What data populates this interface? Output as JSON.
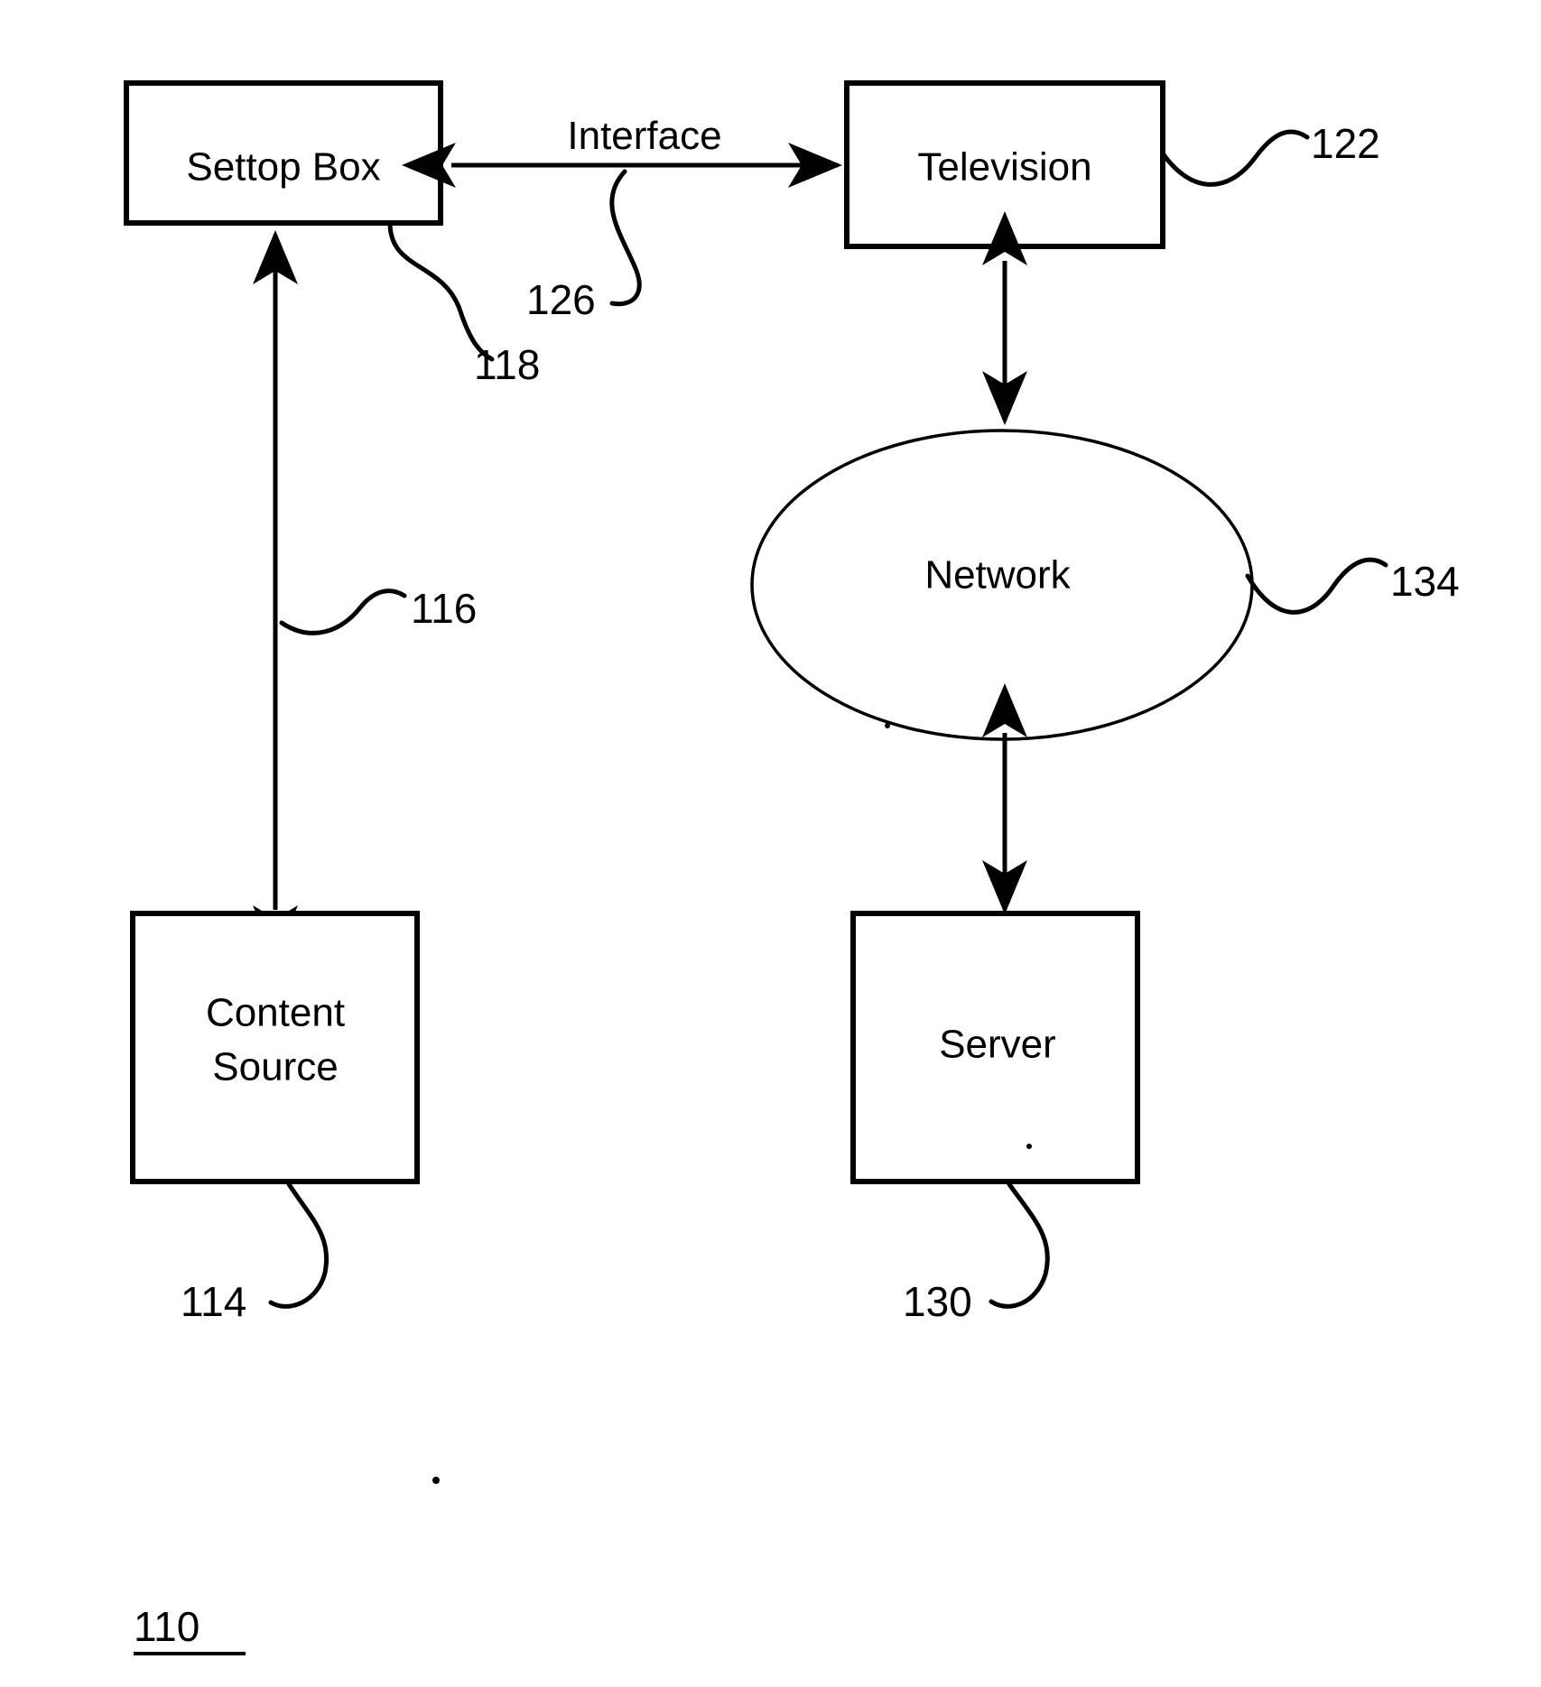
{
  "figure": {
    "figure_number": "110",
    "nodes": [
      {
        "id": "settop_box",
        "label": "Settop Box",
        "shape": "rect",
        "ref": "118"
      },
      {
        "id": "television",
        "label": "Television",
        "shape": "rect",
        "ref": "122"
      },
      {
        "id": "content_source",
        "label_line1": "Content",
        "label_line2": "Source",
        "shape": "rect",
        "ref": "114"
      },
      {
        "id": "network",
        "label": "Network",
        "shape": "ellipse",
        "ref": "134"
      },
      {
        "id": "server",
        "label": "Server",
        "shape": "rect",
        "ref": "130"
      }
    ],
    "edges": [
      {
        "id": "settop_television",
        "label": "Interface",
        "ref": "126",
        "arrows": "both"
      },
      {
        "id": "content_source_settop",
        "label": "",
        "ref": "116",
        "arrows": "both"
      },
      {
        "id": "television_network",
        "label": "",
        "ref": "",
        "arrows": "both"
      },
      {
        "id": "network_server",
        "label": "",
        "ref": "",
        "arrows": "both"
      }
    ],
    "reference_numerals": {
      "settop_box": "118",
      "television": "122",
      "interface": "126",
      "content_link": "116",
      "content_source": "114",
      "network": "134",
      "server": "130"
    },
    "colors": {
      "stroke": "#000000",
      "fill": "#ffffff",
      "background": "#ffffff"
    }
  }
}
